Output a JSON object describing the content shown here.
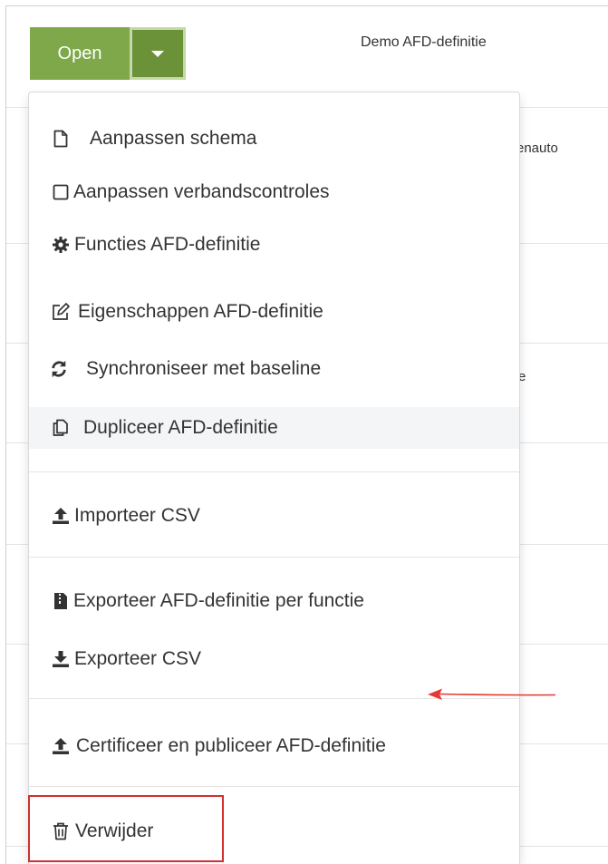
{
  "toolbar": {
    "open_label": "Open"
  },
  "header": {
    "title": "Demo AFD-definitie"
  },
  "background_rows": {
    "row1_fragment": "enauto",
    "row2_fragment": "e"
  },
  "menu": {
    "items": [
      {
        "label": "Aanpassen schema",
        "icon": "file-icon"
      },
      {
        "label": "Aanpassen verbandscontroles",
        "icon": "square-icon"
      },
      {
        "label": "Functies AFD-definitie",
        "icon": "gear-icon"
      },
      {
        "label": "Eigenschappen AFD-definitie",
        "icon": "edit-icon"
      },
      {
        "label": "Synchroniseer met baseline",
        "icon": "sync-icon"
      },
      {
        "label": "Dupliceer AFD-definitie",
        "icon": "copy-icon"
      },
      {
        "label": "Importeer CSV",
        "icon": "upload-icon"
      },
      {
        "label": "Exporteer AFD-definitie per functie",
        "icon": "zip-file-icon"
      },
      {
        "label": "Exporteer CSV",
        "icon": "download-icon"
      },
      {
        "label": "Certificeer en publiceer AFD-definitie",
        "icon": "upload-icon"
      },
      {
        "label": "Verwijder",
        "icon": "trash-icon"
      }
    ]
  },
  "colors": {
    "open_button": "#7ea84a",
    "caret_button": "#6b9139",
    "highlight_box": "#d32f2f",
    "annotation_arrow": "#e53935"
  }
}
